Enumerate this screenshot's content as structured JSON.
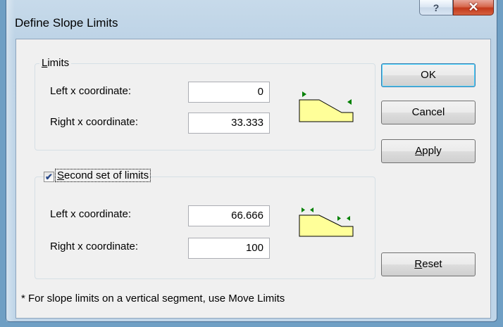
{
  "window": {
    "title": "Define Slope Limits",
    "help_glyph": "?",
    "close_glyph": "✕"
  },
  "limits": {
    "label": "Limits",
    "left_label": "Left x coordinate:",
    "left_value": "0",
    "right_label": "Right x coordinate:",
    "right_value": "33.333",
    "diagram_icon": "slope-limits-single-icon"
  },
  "second_limits": {
    "label": "Second set of limits",
    "checked": true,
    "left_label": "Left x coordinate:",
    "left_value": "66.666",
    "right_label": "Right x coordinate:",
    "right_value": "100",
    "diagram_icon": "slope-limits-double-icon"
  },
  "buttons": {
    "ok": "OK",
    "cancel": "Cancel",
    "apply": "Apply",
    "reset": "Reset"
  },
  "footnote": "* For slope limits on a vertical segment, use Move Limits",
  "colors": {
    "slope_fill": "#ffff99",
    "marker_green": "#008000",
    "accent_blue": "#3c7fb1"
  }
}
